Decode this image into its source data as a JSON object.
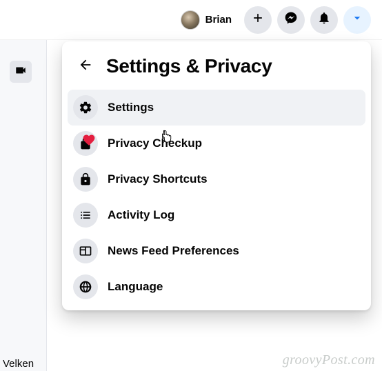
{
  "header": {
    "profile_name": "Brian"
  },
  "dropdown": {
    "title": "Settings & Privacy",
    "items": [
      {
        "label": "Settings"
      },
      {
        "label": "Privacy Checkup"
      },
      {
        "label": "Privacy Shortcuts"
      },
      {
        "label": "Activity Log"
      },
      {
        "label": "News Feed Preferences"
      },
      {
        "label": "Language"
      }
    ]
  },
  "background": {
    "partial_text": "Velken"
  },
  "watermark": "groovyPost.com"
}
